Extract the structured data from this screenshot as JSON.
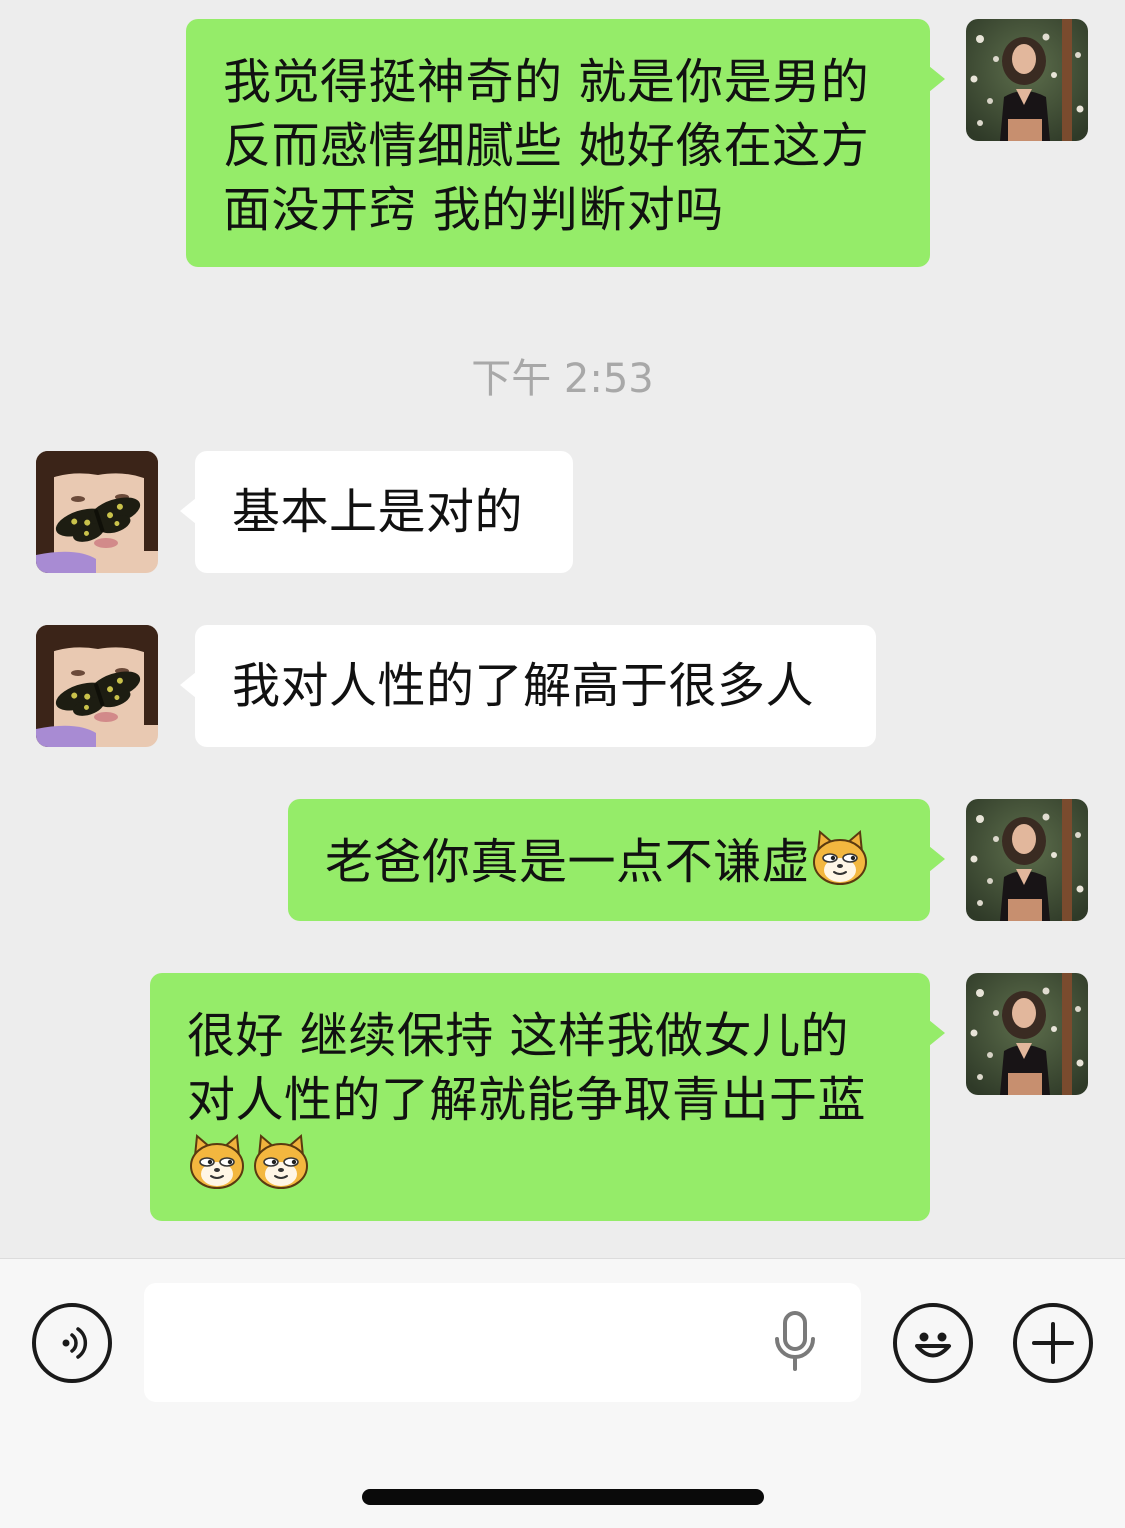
{
  "messages": [
    {
      "sender": "me",
      "lines": [
        "我觉得挺神奇的 就是你是男的",
        "反而感情细腻些 她好像在这方",
        "面没开窍 我的判断对吗"
      ]
    },
    {
      "sender": "them",
      "text": "基本上是对的"
    },
    {
      "sender": "them",
      "text": "我对人性的了解高于很多人"
    },
    {
      "sender": "me",
      "text": "老爸你真是一点不谦虚",
      "emoji": "doge-cat-emoji"
    },
    {
      "sender": "me",
      "lines": [
        "很好 继续保持 这样我做女儿的",
        "对人性的了解就能争取青出于蓝"
      ],
      "emoji_count": 2
    }
  ],
  "timestamp": "下午 2:53",
  "input": {
    "placeholder": ""
  },
  "icons": {
    "voice": "voice-mode-icon",
    "mic": "microphone-icon",
    "emoji": "emoji-face-icon",
    "plus": "plus-icon"
  },
  "colors": {
    "my_bubble": "#95ec69",
    "their_bubble": "#ffffff",
    "background": "#ededed"
  }
}
